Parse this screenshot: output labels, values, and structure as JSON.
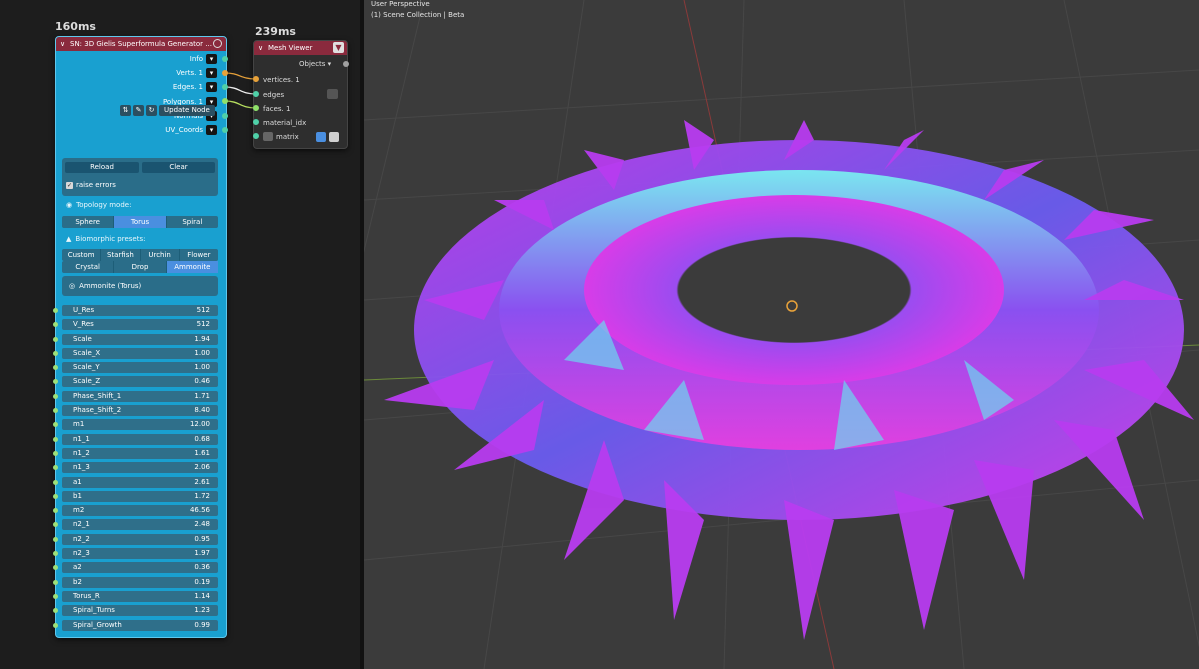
{
  "node_editor": {
    "timing_left": "160ms",
    "timing_right": "239ms",
    "sn_node": {
      "title": "SN: 3D Gielis Superformula Generator ...",
      "outputs": [
        {
          "label": "Info"
        },
        {
          "label": "Verts. 1"
        },
        {
          "label": "Edges. 1"
        },
        {
          "label": "Polygons. 1"
        },
        {
          "label": "Normals"
        },
        {
          "label": "UV_Coords"
        }
      ],
      "update_label": "Update Node",
      "reload_label": "Reload",
      "clear_label": "Clear",
      "raise_errors_label": "raise errors",
      "topology_label": "Topology mode:",
      "topology_options": [
        "Sphere",
        "Torus",
        "Spiral"
      ],
      "topology_selected": "Torus",
      "presets_label": "Biomorphic presets:",
      "presets_row1": [
        "Custom",
        "Starfish",
        "Urchin",
        "Flower"
      ],
      "presets_row2": [
        "Crystal",
        "Drop",
        "Ammonite"
      ],
      "preset_selected": "Ammonite",
      "current_preset": "Ammonite (Torus)",
      "params": [
        {
          "name": "U_Res",
          "value": "512"
        },
        {
          "name": "V_Res",
          "value": "512"
        },
        {
          "name": "Scale",
          "value": "1.94"
        },
        {
          "name": "Scale_X",
          "value": "1.00"
        },
        {
          "name": "Scale_Y",
          "value": "1.00"
        },
        {
          "name": "Scale_Z",
          "value": "0.46"
        },
        {
          "name": "Phase_Shift_1",
          "value": "1.71"
        },
        {
          "name": "Phase_Shift_2",
          "value": "8.40"
        },
        {
          "name": "m1",
          "value": "12.00"
        },
        {
          "name": "n1_1",
          "value": "0.68"
        },
        {
          "name": "n1_2",
          "value": "1.61"
        },
        {
          "name": "n1_3",
          "value": "2.06"
        },
        {
          "name": "a1",
          "value": "2.61"
        },
        {
          "name": "b1",
          "value": "1.72"
        },
        {
          "name": "m2",
          "value": "46.56"
        },
        {
          "name": "n2_1",
          "value": "2.48"
        },
        {
          "name": "n2_2",
          "value": "0.95"
        },
        {
          "name": "n2_3",
          "value": "1.97"
        },
        {
          "name": "a2",
          "value": "0.36"
        },
        {
          "name": "b2",
          "value": "0.19"
        },
        {
          "name": "Torus_R",
          "value": "1.14"
        },
        {
          "name": "Spiral_Turns",
          "value": "1.23"
        },
        {
          "name": "Spiral_Growth",
          "value": "0.99"
        }
      ]
    },
    "mesh_viewer": {
      "title": "Mesh Viewer",
      "objects_label": "Objects",
      "inputs": [
        "vertices. 1",
        "edges",
        "faces. 1",
        "material_idx",
        "matrix"
      ]
    }
  },
  "viewport": {
    "view_name": "User Perspective",
    "collection": "(1) Scene Collection | Beta"
  },
  "colors": {
    "node_teal": "#19a0d0",
    "header_red": "#8a2a3d",
    "selected_blue": "#4a8fe0",
    "mesh_magenta": "#d63cf0",
    "mesh_cyan": "#6ad8f0"
  }
}
